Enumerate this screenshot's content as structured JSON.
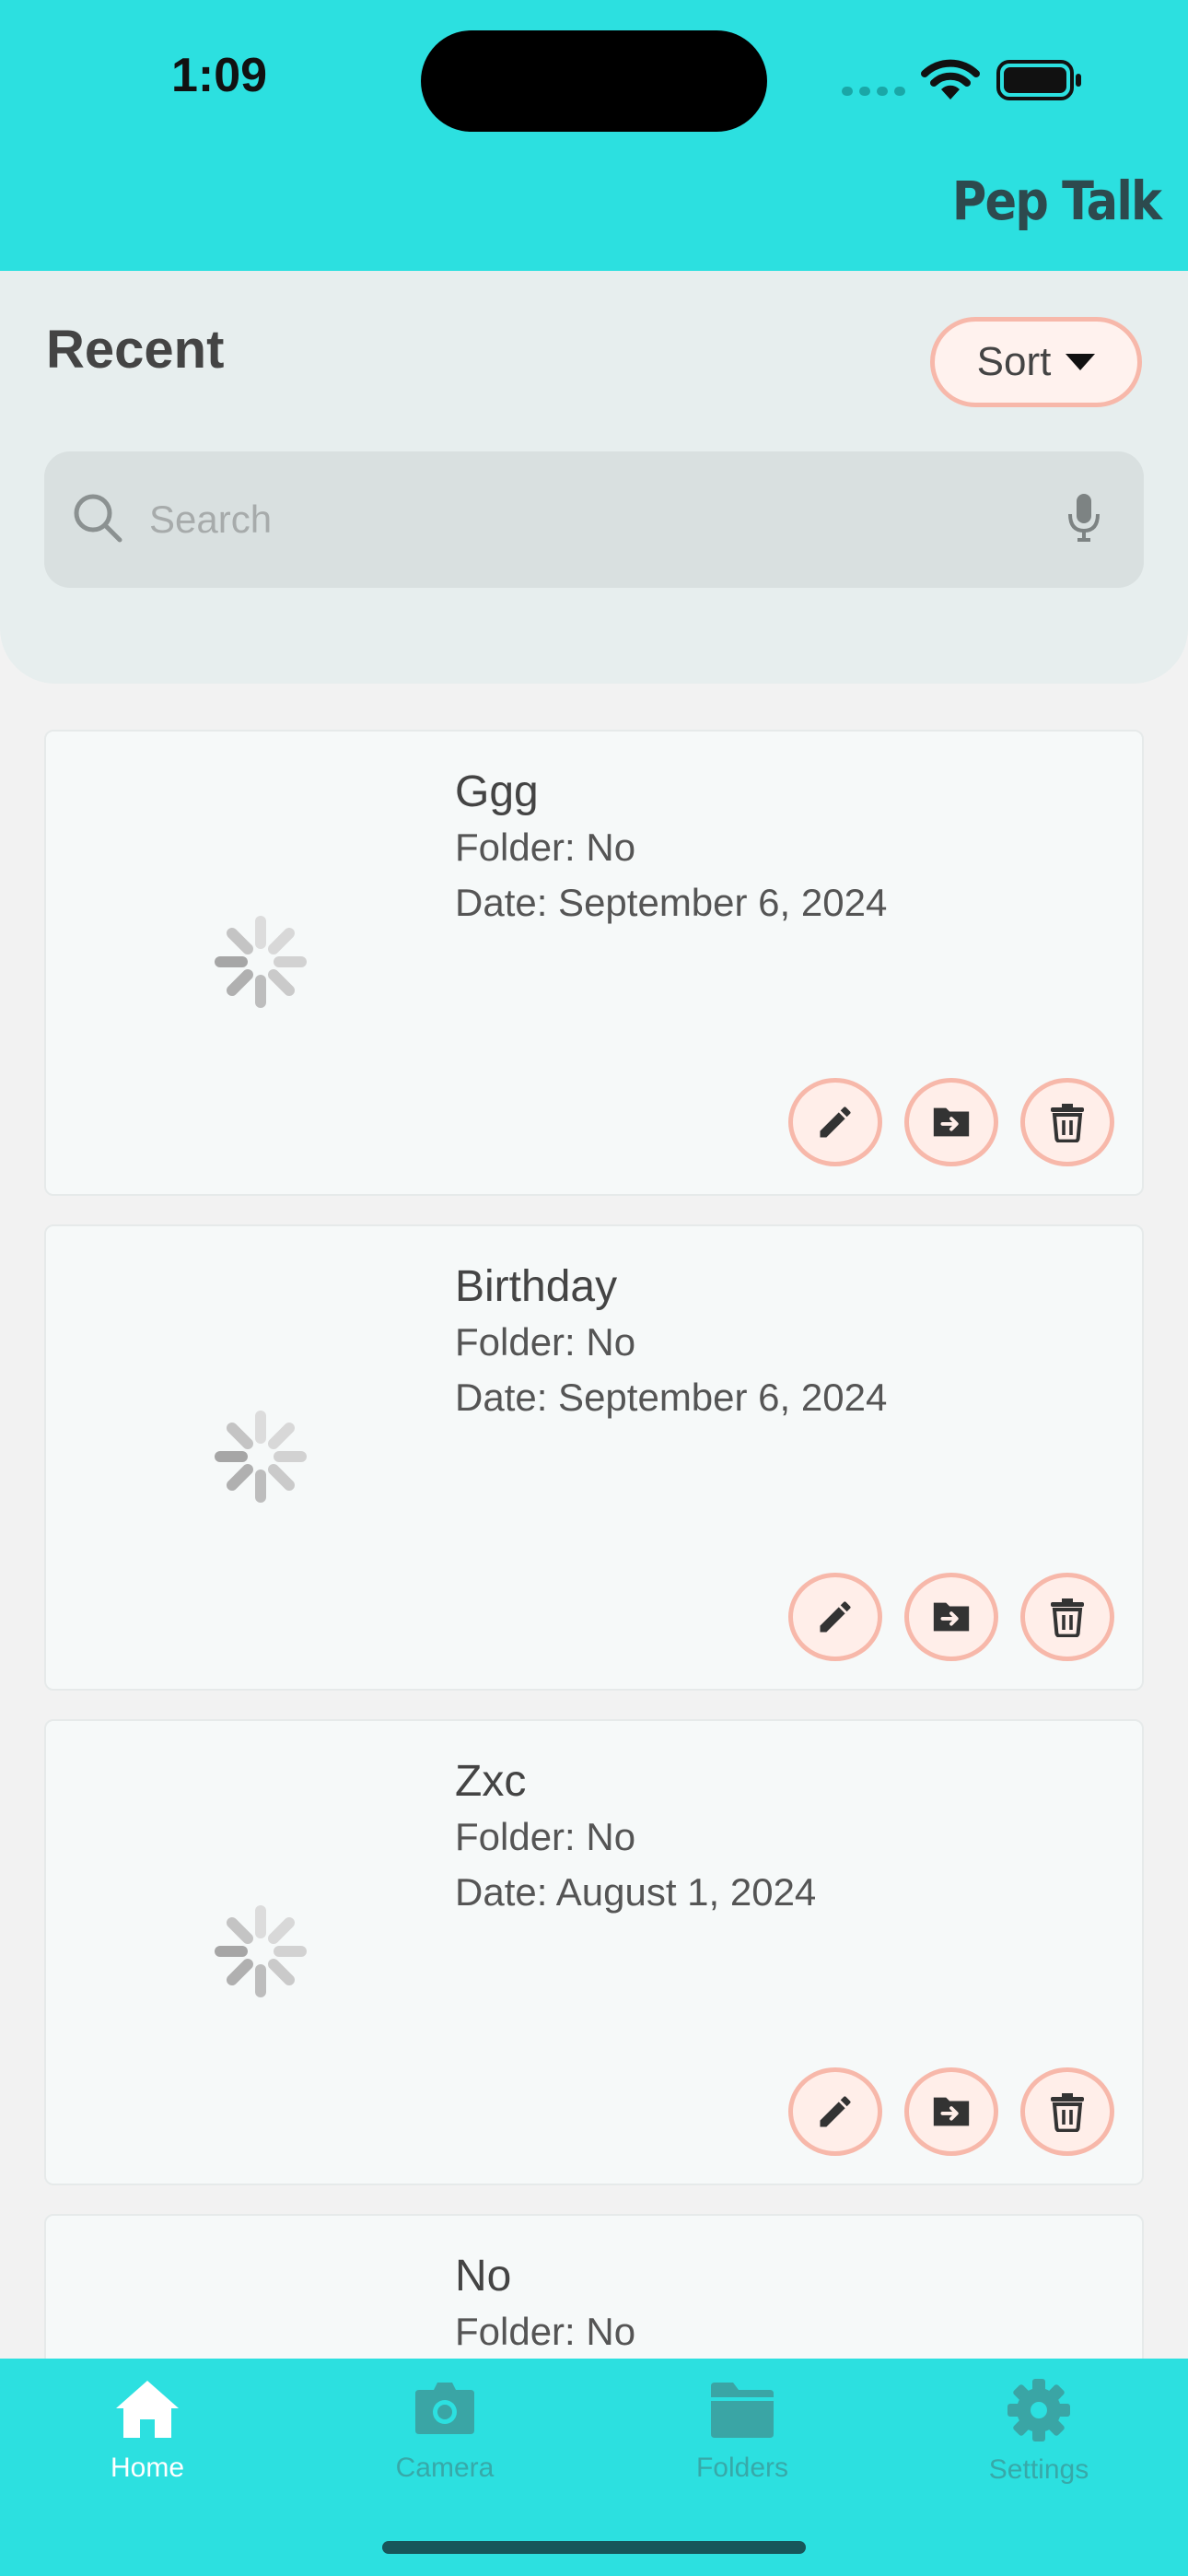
{
  "status_bar": {
    "time": "1:09"
  },
  "header": {
    "brand": "Pep Talk"
  },
  "recent": {
    "title": "Recent",
    "sort_label": "Sort"
  },
  "search": {
    "placeholder": "Search",
    "value": ""
  },
  "cards": [
    {
      "title": "Ggg",
      "folder": "Folder: No",
      "date": "Date: September 6, 2024"
    },
    {
      "title": "Birthday",
      "folder": "Folder: No",
      "date": "Date: September 6, 2024"
    },
    {
      "title": "Zxc",
      "folder": "Folder: No",
      "date": "Date: August 1, 2024"
    },
    {
      "title": "No",
      "folder": "Folder: No",
      "date": ""
    }
  ],
  "nav": {
    "items": [
      {
        "label": "Home",
        "icon": "home-icon",
        "active": true
      },
      {
        "label": "Camera",
        "icon": "camera-icon",
        "active": false
      },
      {
        "label": "Folders",
        "icon": "folder-icon",
        "active": false
      },
      {
        "label": "Settings",
        "icon": "gear-icon",
        "active": false
      }
    ]
  },
  "colors": {
    "header_bg": "#2ce0e0",
    "accent_border": "#f7b8aa",
    "button_fill": "#ffeee9",
    "nav_inactive": "#37a9a9",
    "nav_active": "#ffffff"
  }
}
